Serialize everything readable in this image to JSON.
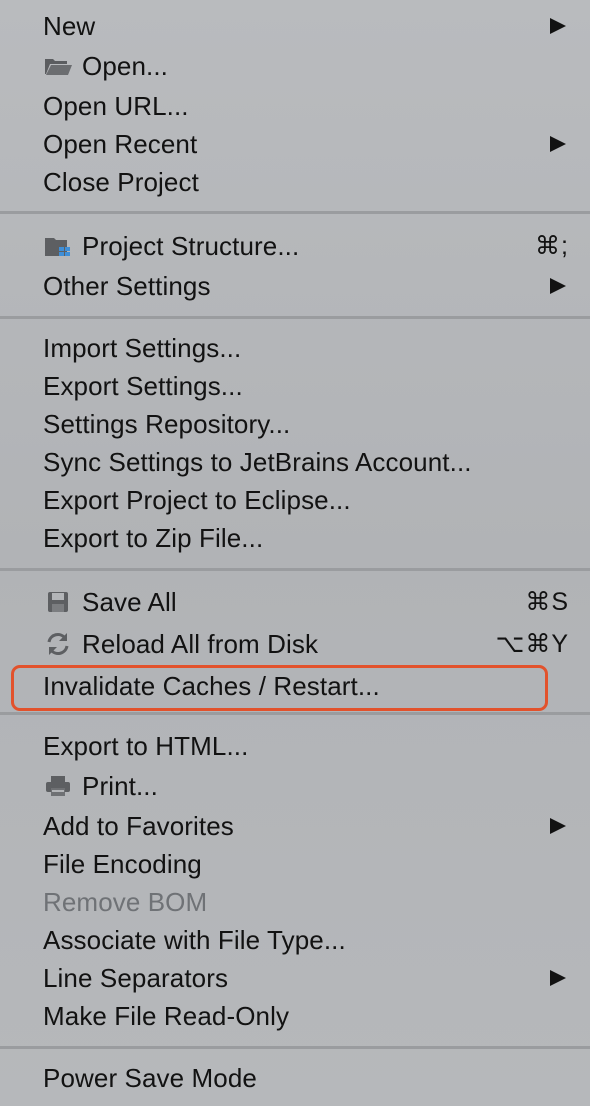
{
  "menu": {
    "items": [
      {
        "label": "New",
        "icon": null,
        "submenu": true,
        "shortcut": ""
      },
      {
        "label": "Open...",
        "icon": "folder-icon",
        "submenu": false,
        "shortcut": ""
      },
      {
        "label": "Open URL...",
        "icon": null,
        "submenu": false,
        "shortcut": ""
      },
      {
        "label": "Open Recent",
        "icon": null,
        "submenu": true,
        "shortcut": ""
      },
      {
        "label": "Close Project",
        "icon": null,
        "submenu": false,
        "shortcut": ""
      },
      {
        "label": "Project Structure...",
        "icon": "project-structure-icon",
        "submenu": false,
        "shortcut": "⌘;"
      },
      {
        "label": "Other Settings",
        "icon": null,
        "submenu": true,
        "shortcut": ""
      },
      {
        "label": "Import Settings...",
        "icon": null,
        "submenu": false,
        "shortcut": ""
      },
      {
        "label": "Export Settings...",
        "icon": null,
        "submenu": false,
        "shortcut": ""
      },
      {
        "label": "Settings Repository...",
        "icon": null,
        "submenu": false,
        "shortcut": ""
      },
      {
        "label": "Sync Settings to JetBrains Account...",
        "icon": null,
        "submenu": false,
        "shortcut": ""
      },
      {
        "label": "Export Project to Eclipse...",
        "icon": null,
        "submenu": false,
        "shortcut": ""
      },
      {
        "label": "Export to Zip File...",
        "icon": null,
        "submenu": false,
        "shortcut": ""
      },
      {
        "label": "Save All",
        "icon": "save-icon",
        "submenu": false,
        "shortcut": "⌘S"
      },
      {
        "label": "Reload All from Disk",
        "icon": "reload-icon",
        "submenu": false,
        "shortcut": "⌥⌘Y"
      },
      {
        "label": "Invalidate Caches / Restart...",
        "icon": null,
        "submenu": false,
        "shortcut": "",
        "highlighted": true
      },
      {
        "label": "Export to HTML...",
        "icon": null,
        "submenu": false,
        "shortcut": ""
      },
      {
        "label": "Print...",
        "icon": "print-icon",
        "submenu": false,
        "shortcut": ""
      },
      {
        "label": "Add to Favorites",
        "icon": null,
        "submenu": true,
        "shortcut": ""
      },
      {
        "label": "File Encoding",
        "icon": null,
        "submenu": false,
        "shortcut": ""
      },
      {
        "label": "Remove BOM",
        "icon": null,
        "submenu": false,
        "shortcut": "",
        "disabled": true
      },
      {
        "label": "Associate with File Type...",
        "icon": null,
        "submenu": false,
        "shortcut": ""
      },
      {
        "label": "Line Separators",
        "icon": null,
        "submenu": true,
        "shortcut": ""
      },
      {
        "label": "Make File Read-Only",
        "icon": null,
        "submenu": false,
        "shortcut": ""
      },
      {
        "label": "Power Save Mode",
        "icon": null,
        "submenu": false,
        "shortcut": ""
      }
    ]
  },
  "colors": {
    "highlight_outline": "#e2522c",
    "disabled_text": "#6f7276",
    "icon_blue": "#3f8fd8"
  }
}
